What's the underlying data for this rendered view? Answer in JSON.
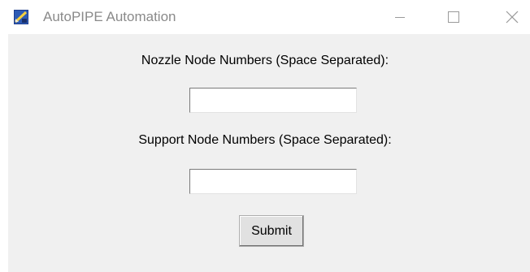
{
  "window": {
    "title": "AutoPIPE Automation",
    "app_icon": "autopipe-app-icon",
    "controls": {
      "minimize_icon": "minimize-icon",
      "maximize_icon": "maximize-icon",
      "close_icon": "close-icon"
    }
  },
  "form": {
    "nozzle_label": "Nozzle Node Numbers (Space Separated):",
    "nozzle_value": "",
    "support_label": "Support Node Numbers (Space Separated):",
    "support_value": "",
    "submit_label": "Submit"
  },
  "colors": {
    "client_background": "#f0f0f0",
    "titlebar_background": "#ffffff",
    "title_text": "#8a8a8a",
    "button_face": "#e1e1e1"
  }
}
